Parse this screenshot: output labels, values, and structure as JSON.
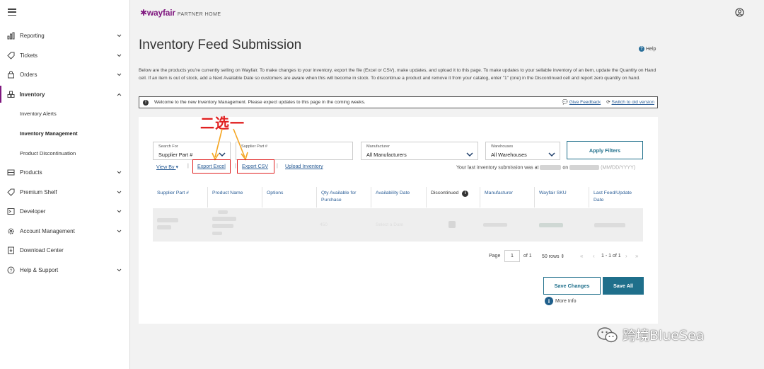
{
  "header": {
    "brand": "wayfair",
    "brand_sub": "PARTNER HOME"
  },
  "sidebar": {
    "items": [
      {
        "label": "Reporting",
        "icon": "bar-chart-icon"
      },
      {
        "label": "Tickets",
        "icon": "tag-icon"
      },
      {
        "label": "Orders",
        "icon": "bag-icon"
      },
      {
        "label": "Inventory",
        "icon": "boxes-icon"
      },
      {
        "label": "Products",
        "icon": "sofa-icon"
      },
      {
        "label": "Premium Shelf",
        "icon": "tag-icon"
      },
      {
        "label": "Developer",
        "icon": "terminal-icon"
      },
      {
        "label": "Account Management",
        "icon": "gear-icon"
      },
      {
        "label": "Download Center",
        "icon": "download-icon"
      },
      {
        "label": "Help & Support",
        "icon": "help-icon"
      }
    ],
    "inventory_sub": [
      "Inventory Alerts",
      "Inventory Management",
      "Product Discontinuation"
    ]
  },
  "page": {
    "title": "Inventory Feed Submission",
    "help": "Help",
    "intro": "Below are the products you're currently selling on Wayfair. To make changes to your inventory, export the file (Excel or CSV), make updates, and upload it to this page. To make updates to your sellable inventory of an item, update the Quantity on Hand cell. If an item is out of stock, add a Next Available Date so customers are aware when this will become in stock. To discontinue a product and remove it from your catalog, enter \"1\" (one) in the Discontinued cell and report zero quantity on hand."
  },
  "banner": {
    "text": "Welcome to the new Inventory Management. Please expect updates to this page in the coming weeks.",
    "feedback": "Give Feedback",
    "switch": "Switch to old version"
  },
  "filters": {
    "search_for_label": "Search For",
    "search_for_value": "Supplier Part #",
    "supplier_part_label": "Supplier Part #",
    "manufacturer_label": "Manufacturer",
    "manufacturer_value": "All Manufacturers",
    "warehouses_label": "Warehouses",
    "warehouses_value": "All Warehouses",
    "apply": "Apply Filters"
  },
  "actions": {
    "view_by": "View By",
    "export_excel": "Export Excel",
    "export_csv": "Export CSV",
    "upload": "Upload Inventory",
    "last_submission_prefix": "Your last inventory submission was at",
    "last_submission_on": "on",
    "date_format": "(MM/DD/YYYY)"
  },
  "annotation": {
    "text": "二选一"
  },
  "table": {
    "columns": [
      "Supplier Part #",
      "Product Name",
      "Options",
      "Qty Available for Purchase",
      "Availability Date",
      "Discontinued",
      "Manufacturer",
      "Wayfair SKU",
      "Last Feed/Update Date"
    ],
    "row_faint_qty": "450",
    "row_faint_date": "Select a Date"
  },
  "pagination": {
    "page_label": "Page",
    "page_value": "1",
    "of": "of 1",
    "rows": "50 rows",
    "range": "1 - 1 of 1"
  },
  "footer": {
    "save_changes": "Save Changes",
    "save_all": "Save All",
    "more_info": "More Info"
  },
  "watermark": {
    "text": "跨境BlueSea"
  }
}
